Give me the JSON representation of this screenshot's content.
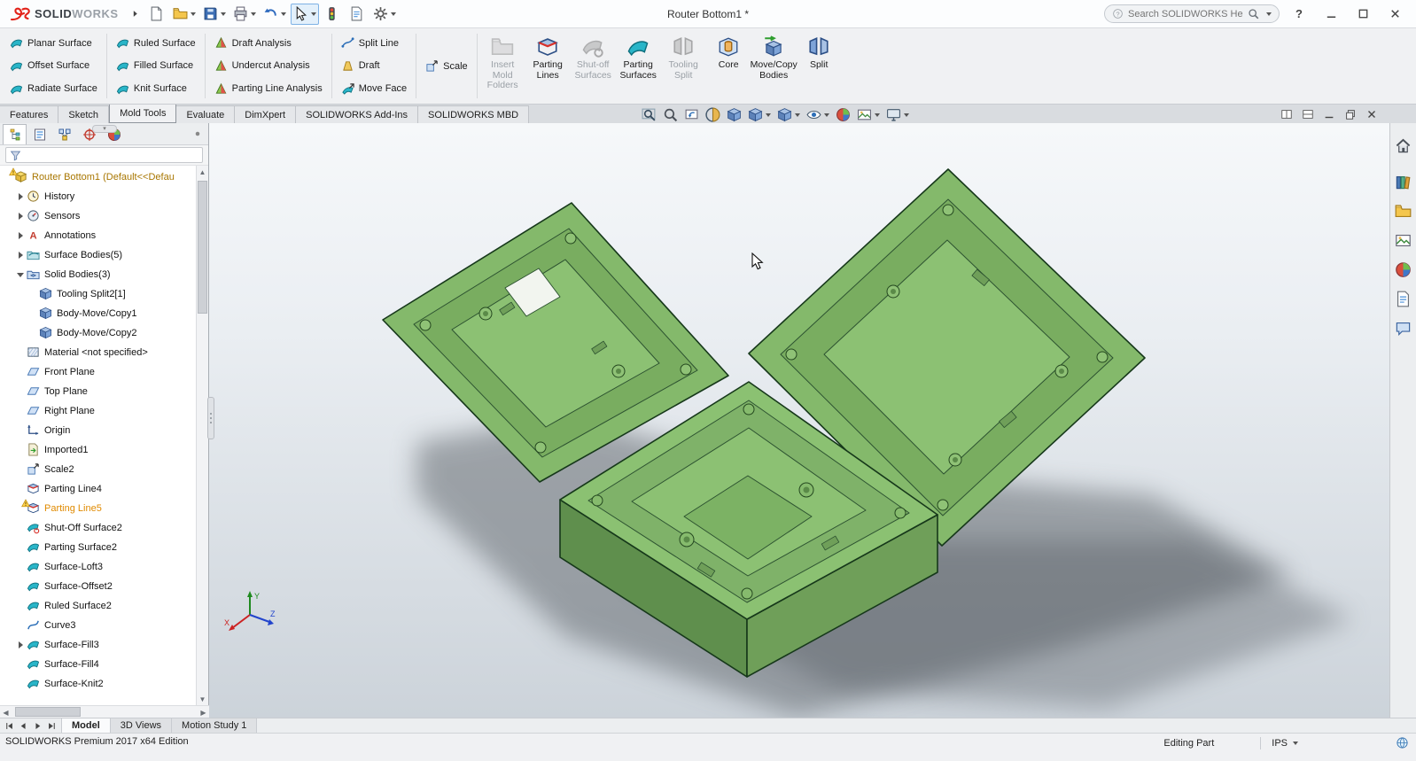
{
  "titlebar": {
    "brand_left": "SOLID",
    "brand_right": "WORKS",
    "document_title": "Router Bottom1 *",
    "search_placeholder": "Search SOLIDWORKS Help",
    "help_label": "?",
    "tools": [
      {
        "icon": "new-document-icon"
      },
      {
        "icon": "open-icon",
        "dropdown": true
      },
      {
        "icon": "save-icon",
        "dropdown": true
      },
      {
        "icon": "print-icon",
        "dropdown": true
      },
      {
        "icon": "undo-icon",
        "dropdown": true
      },
      {
        "icon": "select-icon",
        "dropdown": true,
        "pressed": true
      },
      {
        "icon": "rebuild-icon"
      },
      {
        "icon": "file-properties-icon"
      },
      {
        "icon": "options-icon",
        "dropdown": true
      }
    ],
    "window_controls": [
      "minimize-icon",
      "maximize-icon",
      "close-icon"
    ]
  },
  "ribbon": {
    "columns": [
      [
        {
          "label": "Planar Surface",
          "icon": "planar-surface-icon"
        },
        {
          "label": "Offset Surface",
          "icon": "offset-surface-icon"
        },
        {
          "label": "Radiate Surface",
          "icon": "radiate-surface-icon"
        }
      ],
      [
        {
          "label": "Ruled Surface",
          "icon": "ruled-surface-icon"
        },
        {
          "label": "Filled Surface",
          "icon": "filled-surface-icon"
        },
        {
          "label": "Knit Surface",
          "icon": "knit-surface-icon"
        }
      ],
      [
        {
          "label": "Draft Analysis",
          "icon": "draft-analysis-icon"
        },
        {
          "label": "Undercut Analysis",
          "icon": "undercut-analysis-icon"
        },
        {
          "label": "Parting Line Analysis",
          "icon": "parting-line-analysis-icon"
        }
      ],
      [
        {
          "label": "Split Line",
          "icon": "split-line-icon"
        },
        {
          "label": "Draft",
          "icon": "draft-icon"
        },
        {
          "label": "Move Face",
          "icon": "move-face-icon"
        }
      ],
      [
        {
          "label": "Scale",
          "icon": "scale-icon"
        }
      ]
    ],
    "large_buttons": [
      {
        "label": "Insert Mold Folders",
        "icon": "insert-mold-folders-icon",
        "enabled": false
      },
      {
        "label": "Parting Lines",
        "icon": "parting-lines-icon",
        "enabled": true
      },
      {
        "label": "Shut-off Surfaces",
        "icon": "shut-off-surfaces-icon",
        "enabled": false
      },
      {
        "label": "Parting Surfaces",
        "icon": "parting-surfaces-icon",
        "enabled": true
      },
      {
        "label": "Tooling Split",
        "icon": "tooling-split-icon",
        "enabled": false
      },
      {
        "label": "Core",
        "icon": "core-icon",
        "enabled": true
      },
      {
        "label": "Move/Copy Bodies",
        "icon": "move-copy-bodies-icon",
        "enabled": true
      },
      {
        "label": "Split",
        "icon": "split-icon",
        "enabled": true
      }
    ]
  },
  "command_tabs": {
    "items": [
      {
        "label": "Features"
      },
      {
        "label": "Sketch"
      },
      {
        "label": "Mold Tools",
        "active": true
      },
      {
        "label": "Evaluate"
      },
      {
        "label": "DimXpert"
      },
      {
        "label": "SOLIDWORKS Add-Ins"
      },
      {
        "label": "SOLIDWORKS MBD"
      }
    ]
  },
  "viewport": {
    "hud": [
      {
        "icon": "zoom-to-fit-icon"
      },
      {
        "icon": "zoom-to-area-icon"
      },
      {
        "icon": "previous-view-icon"
      },
      {
        "icon": "section-view-icon"
      },
      {
        "icon": "dynamic-annotation-views-icon"
      },
      {
        "icon": "view-orientation-icon",
        "dropdown": true
      },
      {
        "icon": "display-style-icon",
        "dropdown": true
      },
      {
        "icon": "hide-show-items-icon",
        "dropdown": true
      },
      {
        "icon": "edit-appearance-icon"
      },
      {
        "icon": "apply-scene-icon",
        "dropdown": true
      },
      {
        "icon": "view-settings-icon",
        "dropdown": true
      }
    ],
    "window_controls": [
      "split-horizontal-icon",
      "split-vertical-icon",
      "minimize-document-icon",
      "restore-document-icon",
      "close-document-icon"
    ],
    "triad": {
      "x": "X",
      "y": "Y",
      "z": "Z"
    }
  },
  "feature_panel": {
    "manager_tabs": [
      {
        "icon": "featuremanager-tab-icon",
        "active": true
      },
      {
        "icon": "propertymanager-tab-icon"
      },
      {
        "icon": "configurationmanager-tab-icon"
      },
      {
        "icon": "dimxpertmanager-tab-icon"
      },
      {
        "icon": "displaymanager-tab-icon"
      }
    ],
    "filter_placeholder": "",
    "tree": [
      {
        "label": "Router Bottom1 (Default<<Defau",
        "icon": "part-icon",
        "indent": 0,
        "warn": true,
        "highlight": "root"
      },
      {
        "label": "History",
        "icon": "history-folder-icon",
        "indent": 1,
        "caret": "right"
      },
      {
        "label": "Sensors",
        "icon": "sensors-folder-icon",
        "indent": 1,
        "caret": "right"
      },
      {
        "label": "Annotations",
        "icon": "annotations-folder-icon",
        "indent": 1,
        "caret": "right"
      },
      {
        "label": "Surface Bodies(5)",
        "icon": "surface-bodies-folder-icon",
        "indent": 1,
        "caret": "right"
      },
      {
        "label": "Solid Bodies(3)",
        "icon": "solid-bodies-folder-icon",
        "indent": 1,
        "caret": "down"
      },
      {
        "label": "Tooling Split2[1]",
        "icon": "solid-body-icon",
        "indent": 2
      },
      {
        "label": "Body-Move/Copy1",
        "icon": "solid-body-icon",
        "indent": 2
      },
      {
        "label": "Body-Move/Copy2",
        "icon": "solid-body-icon",
        "indent": 2
      },
      {
        "label": "Material <not specified>",
        "icon": "material-icon",
        "indent": 1
      },
      {
        "label": "Front Plane",
        "icon": "plane-icon",
        "indent": 1
      },
      {
        "label": "Top Plane",
        "icon": "plane-icon",
        "indent": 1
      },
      {
        "label": "Right Plane",
        "icon": "plane-icon",
        "indent": 1
      },
      {
        "label": "Origin",
        "icon": "origin-icon",
        "indent": 1
      },
      {
        "label": "Imported1",
        "icon": "imported-feature-icon",
        "indent": 1
      },
      {
        "label": "Scale2",
        "icon": "scale-feature-icon",
        "indent": 1
      },
      {
        "label": "Parting Line4",
        "icon": "parting-line-feature-icon",
        "indent": 1
      },
      {
        "label": "Parting Line5",
        "icon": "parting-line-feature-icon",
        "indent": 1,
        "warn": true,
        "highlight": "warning"
      },
      {
        "label": "Shut-Off Surface2",
        "icon": "shut-off-surface-feature-icon",
        "indent": 1
      },
      {
        "label": "Parting Surface2",
        "icon": "parting-surface-feature-icon",
        "indent": 1
      },
      {
        "label": "Surface-Loft3",
        "icon": "surface-loft-icon",
        "indent": 1
      },
      {
        "label": "Surface-Offset2",
        "icon": "surface-offset-icon",
        "indent": 1
      },
      {
        "label": "Ruled Surface2",
        "icon": "ruled-surface-feature-icon",
        "indent": 1
      },
      {
        "label": "Curve3",
        "icon": "curve-icon",
        "indent": 1
      },
      {
        "label": "Surface-Fill3",
        "icon": "surface-fill-icon",
        "indent": 1,
        "caret": "right"
      },
      {
        "label": "Surface-Fill4",
        "icon": "surface-fill-icon",
        "indent": 1
      },
      {
        "label": "Surface-Knit2",
        "icon": "surface-knit-icon",
        "indent": 1
      }
    ]
  },
  "task_pane": {
    "icons": [
      "home-icon",
      "design-library-icon",
      "file-explorer-icon",
      "view-palette-icon",
      "appearances-icon",
      "custom-properties-icon",
      "forum-icon"
    ]
  },
  "bottom_bar": {
    "tabs": [
      {
        "label": "Model",
        "active": true
      },
      {
        "label": "3D Views"
      },
      {
        "label": "Motion Study 1"
      }
    ]
  },
  "statusbar": {
    "left": "SOLIDWORKS Premium 2017 x64 Edition",
    "mode": "Editing Part",
    "units": "IPS"
  }
}
